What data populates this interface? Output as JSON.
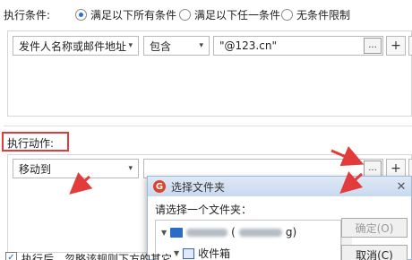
{
  "conditions": {
    "label": "执行条件:",
    "options": [
      {
        "label": "满足以下所有条件",
        "selected": true
      },
      {
        "label": "满足以下任一条件",
        "selected": false
      },
      {
        "label": "无条件限制",
        "selected": false
      }
    ],
    "rule": {
      "field": "发件人名称或邮件地址",
      "operator": "包含",
      "value": "\"@123.cn\"",
      "browse_label": "...",
      "add_label": "+"
    }
  },
  "actions": {
    "label": "执行动作:",
    "rule": {
      "action": "移动到",
      "target_value": "",
      "browse_label": "...",
      "add_label": "+"
    }
  },
  "folder_dialog": {
    "title": "选择文件夹",
    "logo": "G",
    "close": "✕",
    "prompt": "请选择一个文件夹：",
    "ok_label": "确定(O)",
    "cancel_label": "取消(C)",
    "tree": {
      "account_suffix": "(",
      "account_suffix2": "g)",
      "inbox_label": "收件箱"
    }
  },
  "after_execution": {
    "checked": true,
    "label": "执行后，忽略该规则下方的其它"
  },
  "accent_colors": {
    "annotation_red": "#e23b3b",
    "radio_blue": "#2a6fd6"
  }
}
